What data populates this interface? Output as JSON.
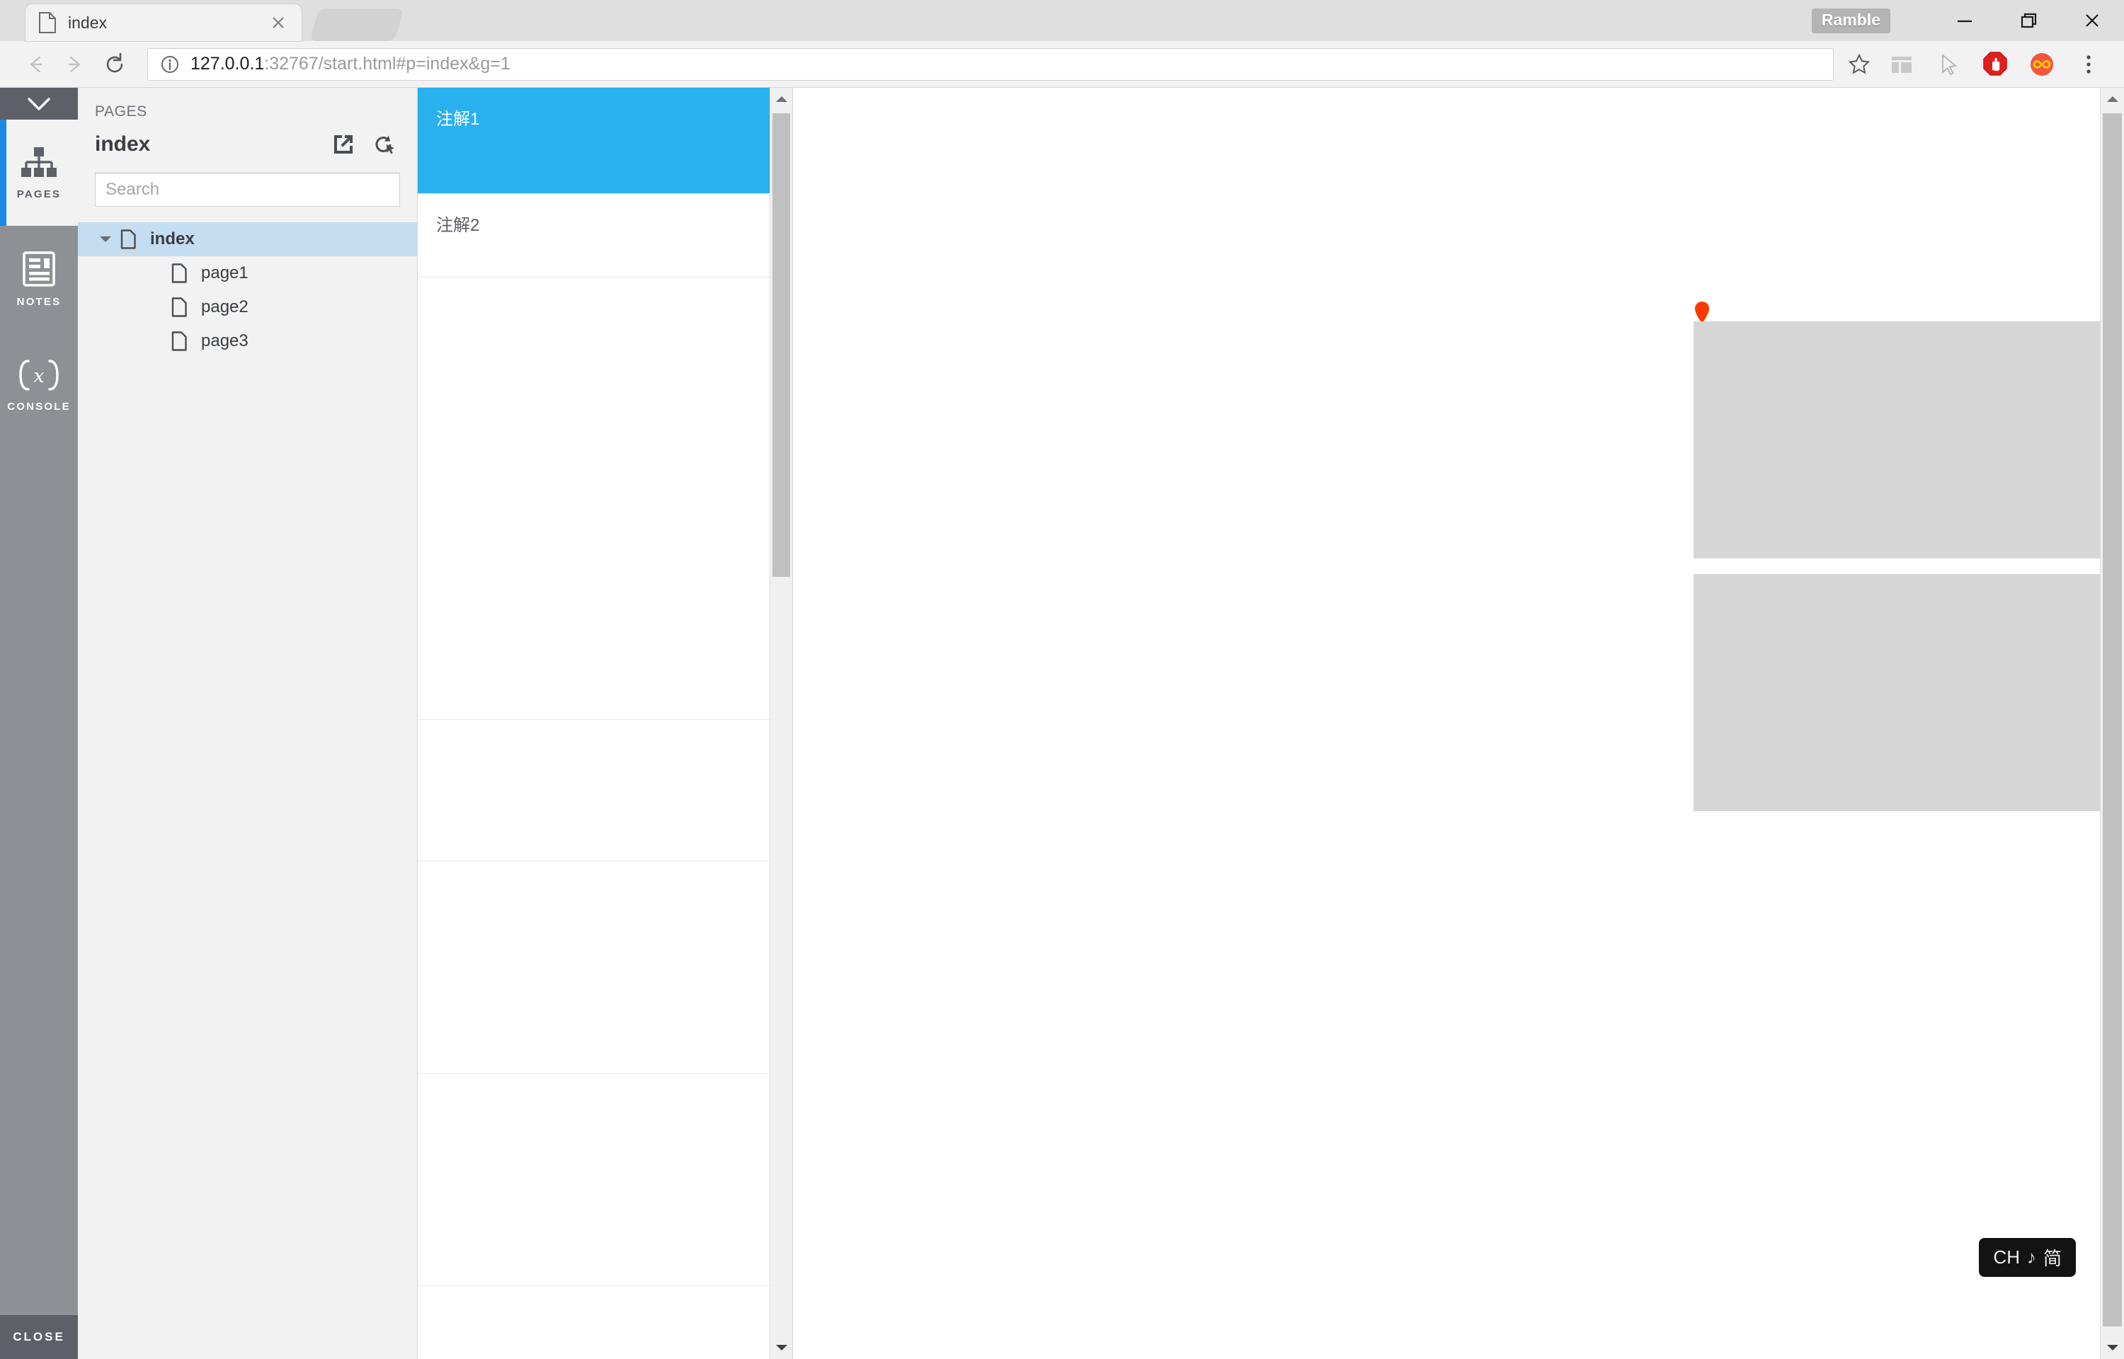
{
  "browser": {
    "tab": {
      "title": "index",
      "favicon_icon": "document-icon",
      "close_icon": "close-icon"
    },
    "new_tab_icon": "new-tab-ghost",
    "window": {
      "ramble_label": "Ramble",
      "minimize_icon": "minimize-icon",
      "restore_icon": "restore-icon",
      "close_icon": "window-close-icon"
    },
    "toolbar": {
      "back_icon": "back-arrow-icon",
      "forward_icon": "forward-arrow-icon",
      "reload_icon": "reload-icon",
      "info_icon": "page-info-icon",
      "url_host": "127.0.0.1",
      "url_rest": ":32767/start.html#p=index&g=1",
      "url_full": "127.0.0.1:32767/start.html#p=index&g=1",
      "star_icon": "bookmark-star-icon",
      "extensions": [
        {
          "name": "layout-extension-icon",
          "color": "#c8c8c8"
        },
        {
          "name": "cursor-extension-icon",
          "color": "#b4b4b4"
        },
        {
          "name": "adblock-extension-icon",
          "color": "#e02020"
        },
        {
          "name": "infinity-extension-icon",
          "color": "#f4553d"
        }
      ],
      "menu_icon": "kebab-menu-icon"
    }
  },
  "rail": {
    "collapse_icon": "chevron-down-icon",
    "items": [
      {
        "label": "PAGES",
        "icon": "sitemap-icon",
        "active": true
      },
      {
        "label": "NOTES",
        "icon": "document-lines-icon",
        "active": false
      },
      {
        "label": "CONSOLE",
        "icon": "fx-icon",
        "active": false
      }
    ],
    "close_label": "CLOSE",
    "accent_color": "#1e88e5",
    "bg_color": "#8d9196"
  },
  "pages_panel": {
    "kicker": "PAGES",
    "title": "index",
    "open_icon": "open-external-icon",
    "reload_icon": "reload-cursor-icon",
    "search": {
      "placeholder": "Search",
      "value": ""
    },
    "tree": [
      {
        "label": "index",
        "icon": "document-icon",
        "selected": true,
        "expanded": true,
        "depth": 0
      },
      {
        "label": "page1",
        "icon": "document-icon",
        "selected": false,
        "expanded": false,
        "depth": 1
      },
      {
        "label": "page2",
        "icon": "document-icon",
        "selected": false,
        "expanded": false,
        "depth": 1
      },
      {
        "label": "page3",
        "icon": "document-icon",
        "selected": false,
        "expanded": false,
        "depth": 1
      }
    ]
  },
  "notes_panel": {
    "notes": [
      {
        "label": "注解1",
        "selected": true
      },
      {
        "label": "注解2",
        "selected": false
      }
    ],
    "selected_color": "#29b0ef",
    "scrollbar": {
      "up_icon": "scroll-up-icon",
      "down_icon": "scroll-down-icon"
    }
  },
  "canvas": {
    "marker_icon": "map-pin-marker",
    "marker_color": "#f93a00",
    "placeholders": [
      {
        "name": "placeholder-box-1"
      },
      {
        "name": "placeholder-box-2"
      },
      {
        "name": "placeholder-box-3"
      },
      {
        "name": "placeholder-box-4"
      }
    ],
    "placeholder_color": "#d6d6d6"
  },
  "ime": {
    "mode": "CH",
    "tone_icon": "♪",
    "script": "简"
  }
}
